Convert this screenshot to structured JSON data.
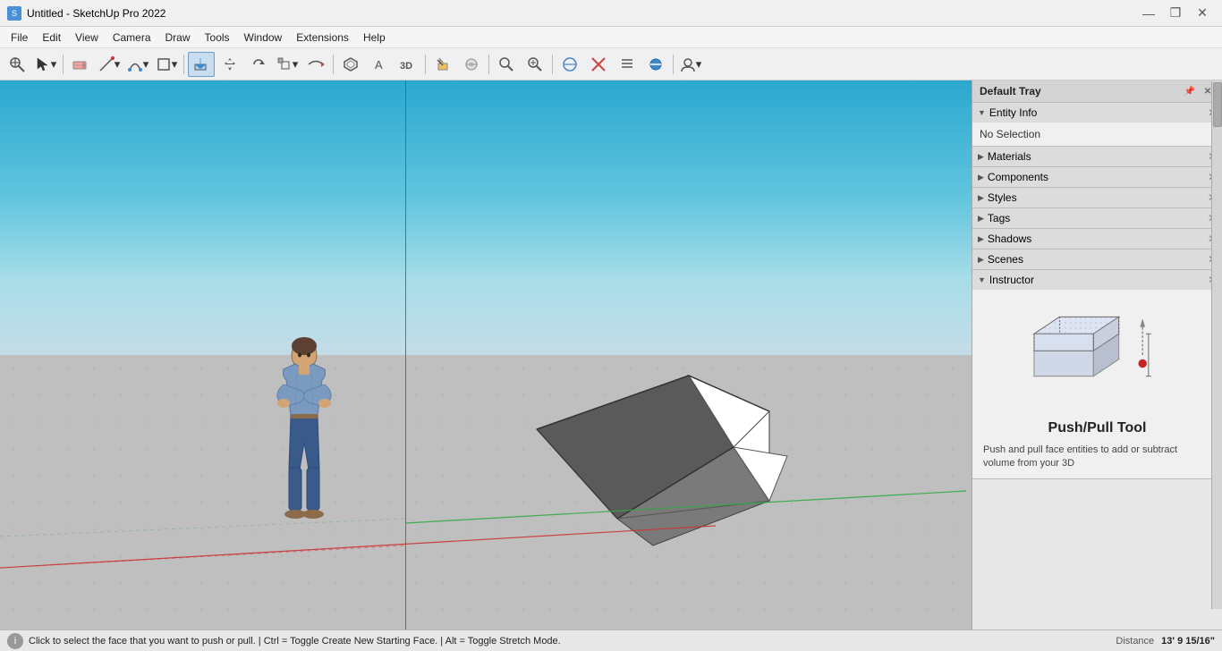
{
  "titlebar": {
    "title": "Untitled - SketchUp Pro 2022",
    "icon": "S",
    "controls": [
      "—",
      "❐",
      "✕"
    ]
  },
  "menubar": {
    "items": [
      "File",
      "Edit",
      "View",
      "Camera",
      "Draw",
      "Tools",
      "Window",
      "Extensions",
      "Help"
    ]
  },
  "toolbar": {
    "tools": [
      {
        "name": "zoom-extents",
        "icon": "⊕",
        "tooltip": "Zoom Extents"
      },
      {
        "name": "select",
        "icon": "↖",
        "tooltip": "Select"
      },
      {
        "name": "eraser",
        "icon": "◻",
        "tooltip": "Eraser"
      },
      {
        "name": "pencil",
        "icon": "✏",
        "tooltip": "Line"
      },
      {
        "name": "arc",
        "icon": "◜",
        "tooltip": "Arc"
      },
      {
        "name": "shape",
        "icon": "⬟",
        "tooltip": "Shape"
      },
      {
        "name": "push-pull",
        "icon": "⟁",
        "tooltip": "Push/Pull",
        "active": true
      },
      {
        "name": "move",
        "icon": "✛",
        "tooltip": "Move"
      },
      {
        "name": "rotate",
        "icon": "↻",
        "tooltip": "Rotate"
      },
      {
        "name": "scale",
        "icon": "⤡",
        "tooltip": "Scale"
      },
      {
        "name": "follow-me",
        "icon": "⇒",
        "tooltip": "Follow Me"
      },
      {
        "name": "offset",
        "icon": "⬡",
        "tooltip": "Offset"
      },
      {
        "name": "text",
        "icon": "A",
        "tooltip": "Text"
      },
      {
        "name": "3d-text",
        "icon": "③",
        "tooltip": "3D Text"
      },
      {
        "name": "paint",
        "icon": "⋈",
        "tooltip": "Paint Bucket"
      },
      {
        "name": "tape",
        "icon": "✂",
        "tooltip": "Tape Measure"
      },
      {
        "name": "zoom",
        "icon": "🔍",
        "tooltip": "Zoom"
      },
      {
        "name": "zoom-window",
        "icon": "⊞",
        "tooltip": "Zoom Window"
      },
      {
        "name": "section-plane",
        "icon": "⧉",
        "tooltip": "Section Plane"
      },
      {
        "name": "section-cut",
        "icon": "✖",
        "tooltip": "Section Cut"
      },
      {
        "name": "section-display",
        "icon": "≡",
        "tooltip": "Section Display"
      },
      {
        "name": "section-fill",
        "icon": "⊛",
        "tooltip": "Section Fill"
      },
      {
        "name": "account",
        "icon": "👤",
        "tooltip": "Account"
      }
    ]
  },
  "viewport": {
    "background_top": "#2ba8d0",
    "background_bottom": "#c0bfbf"
  },
  "rightpanel": {
    "title": "Default Tray",
    "sections": {
      "entity_info": {
        "label": "Entity Info",
        "expanded": true,
        "content": "No Selection"
      },
      "materials": {
        "label": "Materials",
        "expanded": false
      },
      "components": {
        "label": "Components",
        "expanded": false
      },
      "styles": {
        "label": "Styles",
        "expanded": false
      },
      "tags": {
        "label": "Tags",
        "expanded": false
      },
      "shadows": {
        "label": "Shadows",
        "expanded": false
      },
      "scenes": {
        "label": "Scenes",
        "expanded": false
      },
      "instructor": {
        "label": "Instructor",
        "expanded": true,
        "tool_name": "Push/Pull Tool",
        "tool_desc": "Push and pull face entities to add or subtract volume from your 3D"
      }
    }
  },
  "statusbar": {
    "info_icon": "i",
    "status_text": "Click to select the face that you want to push or pull. | Ctrl = Toggle Create New Starting Face. | Alt = Toggle Stretch Mode.",
    "distance_label": "Distance",
    "distance_value": "13' 9 15/16\""
  }
}
